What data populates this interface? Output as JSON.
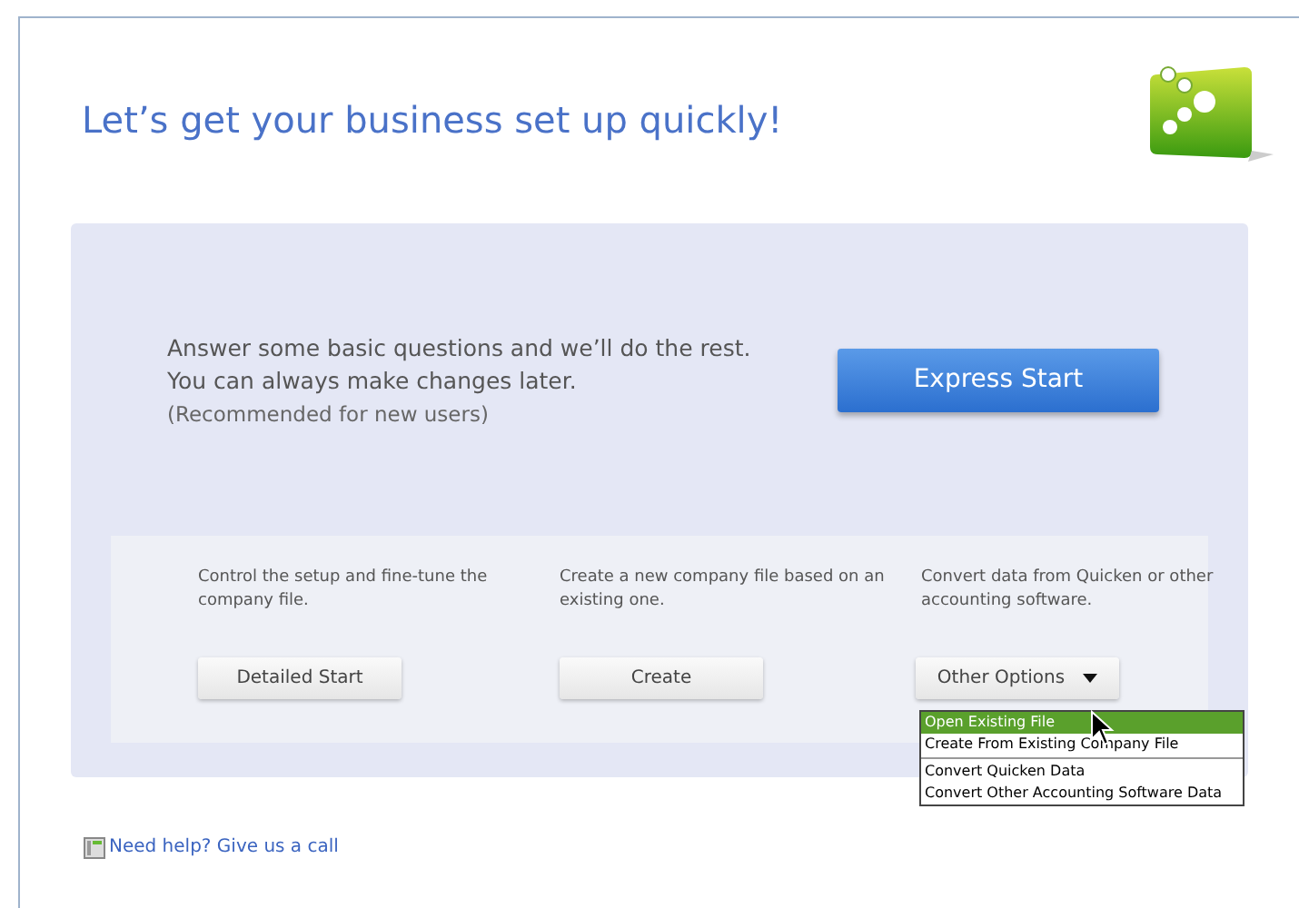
{
  "title": "Let’s get your business set up quickly!",
  "express": {
    "description": "Answer some basic questions and we’ll do the rest. You can always make changes later.",
    "note": "(Recommended for new users)",
    "button": "Express Start"
  },
  "options": [
    {
      "description": "Control the setup and fine-tune the company file.",
      "button": "Detailed Start",
      "kind": "button"
    },
    {
      "description": "Create a new company file based on an existing one.",
      "button": "Create",
      "kind": "button"
    },
    {
      "description": "Convert data from Quicken or other accounting software.",
      "button": "Other Options",
      "kind": "dropdown"
    }
  ],
  "menu": {
    "groups": [
      [
        {
          "label": "Open Existing File",
          "selected": true
        },
        {
          "label": "Create From Existing Company File",
          "selected": false
        }
      ],
      [
        {
          "label": "Convert Quicken Data",
          "selected": false
        },
        {
          "label": "Convert Other Accounting Software Data",
          "selected": false
        }
      ]
    ]
  },
  "help_link": "Need help? Give us a call"
}
